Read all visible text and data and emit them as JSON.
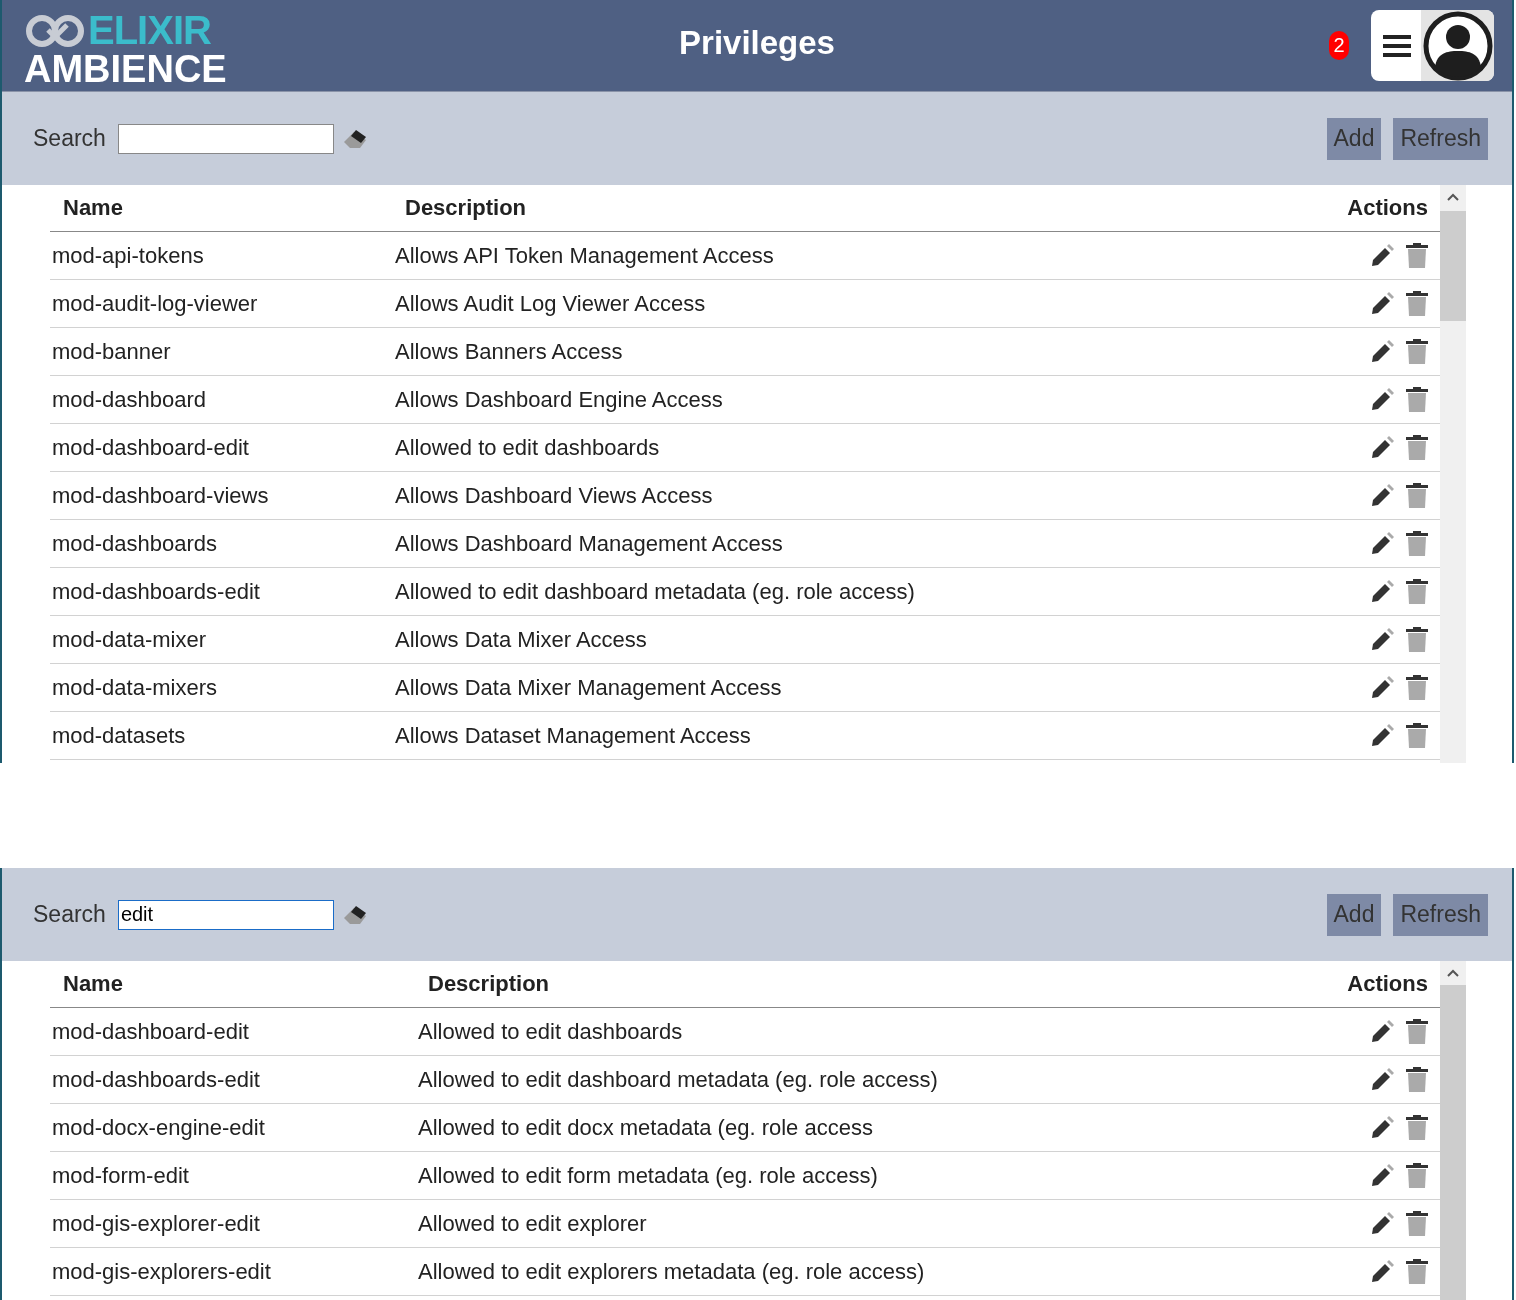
{
  "header": {
    "logo_top": "ELIXIR",
    "logo_bottom": "AMBIENCE",
    "title": "Privileges",
    "notification_count": "2"
  },
  "panels": [
    {
      "search": {
        "label": "Search"
      },
      "buttons": [
        "Add",
        "Refresh"
      ],
      "table": {
        "columns": [
          "Name",
          "Description",
          "Actions"
        ],
        "rows": [
          {
            "name": "mod-api-tokens",
            "description": "Allows API Token Management Access"
          },
          {
            "name": "mod-audit-log-viewer",
            "description": "Allows Audit Log Viewer Access"
          },
          {
            "name": "mod-banner",
            "description": "Allows Banners Access"
          },
          {
            "name": "mod-dashboard",
            "description": "Allows Dashboard Engine Access"
          },
          {
            "name": "mod-dashboard-edit",
            "description": "Allowed to edit dashboards"
          },
          {
            "name": "mod-dashboard-views",
            "description": "Allows Dashboard Views Access"
          },
          {
            "name": "mod-dashboards",
            "description": "Allows Dashboard Management Access"
          },
          {
            "name": "mod-dashboards-edit",
            "description": "Allowed to edit dashboard metadata (eg. role access)"
          },
          {
            "name": "mod-data-mixer",
            "description": "Allows Data Mixer Access"
          },
          {
            "name": "mod-data-mixers",
            "description": "Allows Data Mixer Management Access"
          },
          {
            "name": "mod-datasets",
            "description": "Allows Dataset Management Access"
          }
        ]
      }
    },
    {
      "search": {
        "label": "Search",
        "value": "edit"
      },
      "buttons": [
        "Add",
        "Refresh"
      ],
      "table": {
        "columns": [
          "Name",
          "Description",
          "Actions"
        ],
        "rows": [
          {
            "name": "mod-dashboard-edit",
            "description": "Allowed to edit dashboards"
          },
          {
            "name": "mod-dashboards-edit",
            "description": "Allowed to edit dashboard metadata (eg. role access)"
          },
          {
            "name": "mod-docx-engine-edit",
            "description": "Allowed to edit docx metadata (eg. role access"
          },
          {
            "name": "mod-form-edit",
            "description": "Allowed to edit form metadata (eg. role access)"
          },
          {
            "name": "mod-gis-explorer-edit",
            "description": "Allowed to edit explorer"
          },
          {
            "name": "mod-gis-explorers-edit",
            "description": "Allowed to edit explorers metadata (eg. role access)"
          }
        ]
      }
    }
  ]
}
